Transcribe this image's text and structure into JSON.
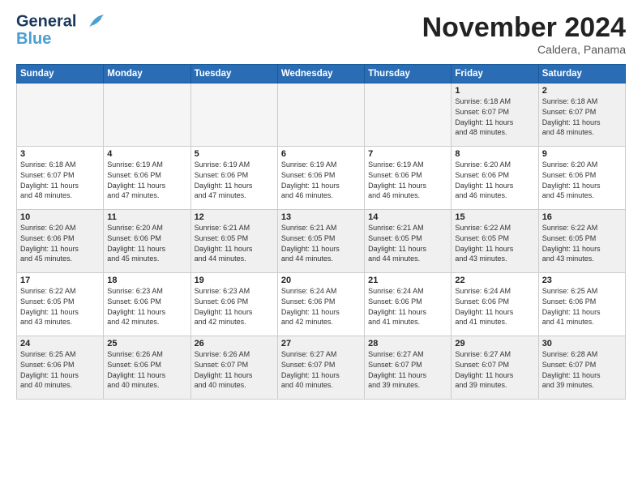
{
  "logo": {
    "line1": "General",
    "line2": "Blue"
  },
  "title": "November 2024",
  "subtitle": "Caldera, Panama",
  "days_of_week": [
    "Sunday",
    "Monday",
    "Tuesday",
    "Wednesday",
    "Thursday",
    "Friday",
    "Saturday"
  ],
  "weeks": [
    [
      {
        "day": "",
        "info": "",
        "empty": true
      },
      {
        "day": "",
        "info": "",
        "empty": true
      },
      {
        "day": "",
        "info": "",
        "empty": true
      },
      {
        "day": "",
        "info": "",
        "empty": true
      },
      {
        "day": "",
        "info": "",
        "empty": true
      },
      {
        "day": "1",
        "info": "Sunrise: 6:18 AM\nSunset: 6:07 PM\nDaylight: 11 hours\nand 48 minutes."
      },
      {
        "day": "2",
        "info": "Sunrise: 6:18 AM\nSunset: 6:07 PM\nDaylight: 11 hours\nand 48 minutes."
      }
    ],
    [
      {
        "day": "3",
        "info": "Sunrise: 6:18 AM\nSunset: 6:07 PM\nDaylight: 11 hours\nand 48 minutes."
      },
      {
        "day": "4",
        "info": "Sunrise: 6:19 AM\nSunset: 6:06 PM\nDaylight: 11 hours\nand 47 minutes."
      },
      {
        "day": "5",
        "info": "Sunrise: 6:19 AM\nSunset: 6:06 PM\nDaylight: 11 hours\nand 47 minutes."
      },
      {
        "day": "6",
        "info": "Sunrise: 6:19 AM\nSunset: 6:06 PM\nDaylight: 11 hours\nand 46 minutes."
      },
      {
        "day": "7",
        "info": "Sunrise: 6:19 AM\nSunset: 6:06 PM\nDaylight: 11 hours\nand 46 minutes."
      },
      {
        "day": "8",
        "info": "Sunrise: 6:20 AM\nSunset: 6:06 PM\nDaylight: 11 hours\nand 46 minutes."
      },
      {
        "day": "9",
        "info": "Sunrise: 6:20 AM\nSunset: 6:06 PM\nDaylight: 11 hours\nand 45 minutes."
      }
    ],
    [
      {
        "day": "10",
        "info": "Sunrise: 6:20 AM\nSunset: 6:06 PM\nDaylight: 11 hours\nand 45 minutes."
      },
      {
        "day": "11",
        "info": "Sunrise: 6:20 AM\nSunset: 6:06 PM\nDaylight: 11 hours\nand 45 minutes."
      },
      {
        "day": "12",
        "info": "Sunrise: 6:21 AM\nSunset: 6:05 PM\nDaylight: 11 hours\nand 44 minutes."
      },
      {
        "day": "13",
        "info": "Sunrise: 6:21 AM\nSunset: 6:05 PM\nDaylight: 11 hours\nand 44 minutes."
      },
      {
        "day": "14",
        "info": "Sunrise: 6:21 AM\nSunset: 6:05 PM\nDaylight: 11 hours\nand 44 minutes."
      },
      {
        "day": "15",
        "info": "Sunrise: 6:22 AM\nSunset: 6:05 PM\nDaylight: 11 hours\nand 43 minutes."
      },
      {
        "day": "16",
        "info": "Sunrise: 6:22 AM\nSunset: 6:05 PM\nDaylight: 11 hours\nand 43 minutes."
      }
    ],
    [
      {
        "day": "17",
        "info": "Sunrise: 6:22 AM\nSunset: 6:05 PM\nDaylight: 11 hours\nand 43 minutes."
      },
      {
        "day": "18",
        "info": "Sunrise: 6:23 AM\nSunset: 6:06 PM\nDaylight: 11 hours\nand 42 minutes."
      },
      {
        "day": "19",
        "info": "Sunrise: 6:23 AM\nSunset: 6:06 PM\nDaylight: 11 hours\nand 42 minutes."
      },
      {
        "day": "20",
        "info": "Sunrise: 6:24 AM\nSunset: 6:06 PM\nDaylight: 11 hours\nand 42 minutes."
      },
      {
        "day": "21",
        "info": "Sunrise: 6:24 AM\nSunset: 6:06 PM\nDaylight: 11 hours\nand 41 minutes."
      },
      {
        "day": "22",
        "info": "Sunrise: 6:24 AM\nSunset: 6:06 PM\nDaylight: 11 hours\nand 41 minutes."
      },
      {
        "day": "23",
        "info": "Sunrise: 6:25 AM\nSunset: 6:06 PM\nDaylight: 11 hours\nand 41 minutes."
      }
    ],
    [
      {
        "day": "24",
        "info": "Sunrise: 6:25 AM\nSunset: 6:06 PM\nDaylight: 11 hours\nand 40 minutes."
      },
      {
        "day": "25",
        "info": "Sunrise: 6:26 AM\nSunset: 6:06 PM\nDaylight: 11 hours\nand 40 minutes."
      },
      {
        "day": "26",
        "info": "Sunrise: 6:26 AM\nSunset: 6:07 PM\nDaylight: 11 hours\nand 40 minutes."
      },
      {
        "day": "27",
        "info": "Sunrise: 6:27 AM\nSunset: 6:07 PM\nDaylight: 11 hours\nand 40 minutes."
      },
      {
        "day": "28",
        "info": "Sunrise: 6:27 AM\nSunset: 6:07 PM\nDaylight: 11 hours\nand 39 minutes."
      },
      {
        "day": "29",
        "info": "Sunrise: 6:27 AM\nSunset: 6:07 PM\nDaylight: 11 hours\nand 39 minutes."
      },
      {
        "day": "30",
        "info": "Sunrise: 6:28 AM\nSunset: 6:07 PM\nDaylight: 11 hours\nand 39 minutes."
      }
    ]
  ]
}
